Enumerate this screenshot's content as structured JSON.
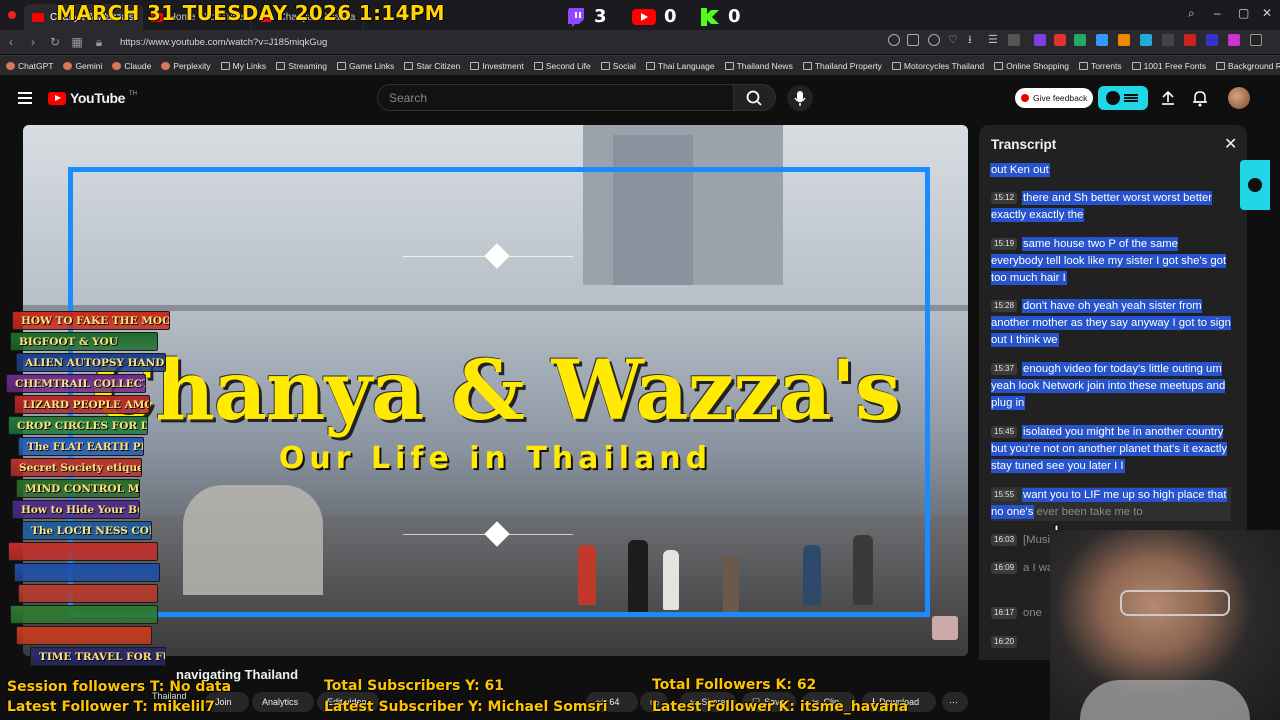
{
  "overlay": {
    "date": "MARCH 31 TUESDAY 2026 1:14PM",
    "twitch_count": "3",
    "youtube_count": "0",
    "kick_count": "0",
    "session_followers": "Session followers T: No data",
    "latest_follower_t": "Latest Follower T: mikelil7",
    "total_subscribers": "Total Subscribers Y: 61",
    "latest_subscriber": "Latest Subscriber Y: Michael Somsri",
    "total_followers_k": "Total Followers K: 62",
    "latest_follower_k": "Latest Follower K: itsme_havana"
  },
  "browser": {
    "tabs": [
      {
        "label": "Chanya & Wazza's"
      },
      {
        "label": "Home - YouTube"
      },
      {
        "label": "Chanya & Wazza"
      }
    ],
    "url": "https://www.youtube.com/watch?v=J185miqkGug",
    "bookmarks": [
      "ChatGPT",
      "Gemini",
      "Claude",
      "Perplexity",
      "My Links",
      "Streaming",
      "Game Links",
      "Star Citizen",
      "Investment",
      "Second Life",
      "Social",
      "Thai Language",
      "Thailand News",
      "Thailand Property",
      "Motorcycles Thailand",
      "Online Shopping",
      "Torrents",
      "1001 Free Fonts",
      "Background Remover"
    ]
  },
  "youtube": {
    "logo": "YouTube",
    "logo_sup": "TH",
    "search_placeholder": "Search",
    "feedback_label": "Give feedback"
  },
  "video": {
    "title_main": "Chanya & Wazza's",
    "title_sub": "Our Life in Thailand",
    "below_title": "navigating Thailand",
    "channel": "Thailand",
    "actions": [
      "Join",
      "Analytics",
      "Edit video",
      "64",
      "Share",
      "Save",
      "Clip",
      "Download"
    ]
  },
  "books": [
    "HOW TO FAKE THE MOON LANDING",
    "BIGFOOT & YOU",
    "ALIEN AUTOPSY HANDBOOK",
    "CHEMTRAIL COLLECTION GUIDE",
    "LIZARD PEOPLE AMONG US",
    "CROP CIRCLES FOR DUMMIES",
    "The FLAT EARTH PRIMER",
    "Secret Society etiquette",
    "MIND CONTROL MADE EASY",
    "How to Hide Your Bunker",
    "The LOCH NESS CONSPIRACY",
    "",
    "",
    "",
    "",
    "",
    "TIME TRAVEL FOR FUN & PROFIT"
  ],
  "transcript": {
    "title": "Transcript",
    "segments": [
      {
        "ts": "",
        "text": "out Ken out",
        "dim": ""
      },
      {
        "ts": "15:12",
        "text": "there and Sh better worst worst better exactly exactly the",
        "dim": ""
      },
      {
        "ts": "15:19",
        "text": "same house two P of the same everybody tell look like my sister I got she's got too much hair I",
        "dim": ""
      },
      {
        "ts": "15:28",
        "text": "don't have oh yeah yeah sister from another mother as they say anyway I got to sign out I think we",
        "dim": ""
      },
      {
        "ts": "15:37",
        "text": "enough video for today's little outing um yeah look Network join into these meetups and plug in",
        "dim": ""
      },
      {
        "ts": "15:45",
        "text": "isolated you might be in another country but you're not on another planet that's it exactly stay tuned see you later I I",
        "dim": ""
      },
      {
        "ts": "15:55",
        "text": "want you to LIF me up so high place that no one's",
        "dim": " ever been take me to"
      },
      {
        "ts": "16:03",
        "text": "",
        "dim": "[Music]"
      },
      {
        "ts": "16:09",
        "text": "",
        "dim": "a I want you a place no"
      },
      {
        "ts": "16:17",
        "text": "",
        "dim": "one"
      },
      {
        "ts": "16:20",
        "text": "",
        "dim": ""
      }
    ]
  },
  "colors": {
    "accent_blue": "#1a8cff",
    "title_yellow": "#ffea00",
    "highlight": "#2753cc",
    "yt_red": "#ff0000",
    "overlay_gold": "#ffc400"
  }
}
